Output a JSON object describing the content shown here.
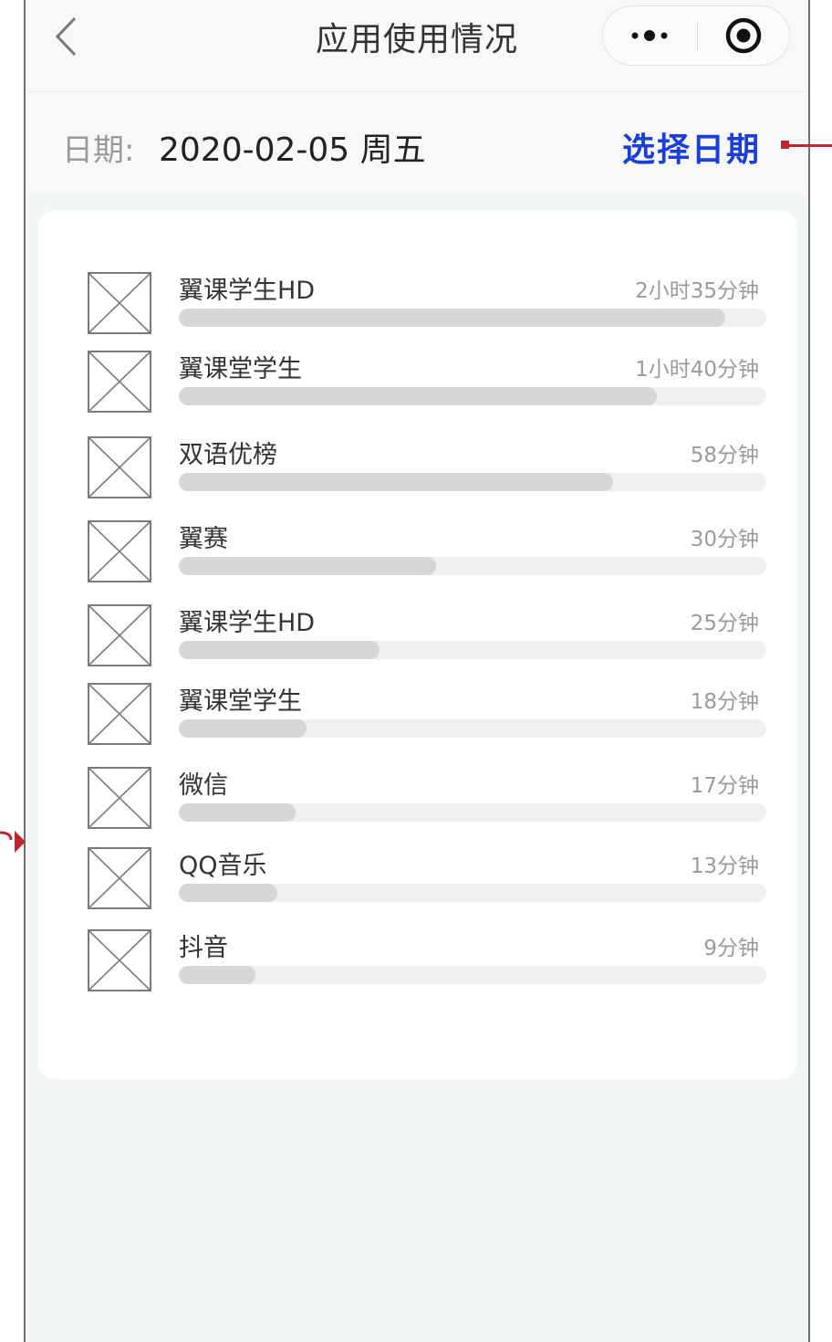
{
  "header": {
    "title": "应用使用情况",
    "back_icon": "chevron-left-icon",
    "more_icon": "more-dots-icon",
    "close_icon": "target-circle-icon"
  },
  "date_bar": {
    "label": "日期:",
    "value": "2020-02-05 周五",
    "pick_label": "选择日期"
  },
  "colors": {
    "accent": "#1a3fd8",
    "bar_fill": "#d6d6d6",
    "bar_track": "#f0f0f0",
    "annotation": "#c0262d"
  },
  "apps": [
    {
      "name": "翼课学生HD",
      "time": "2小时35分钟",
      "minutes": 155
    },
    {
      "name": "翼课堂学生",
      "time": "1小时40分钟",
      "minutes": 100
    },
    {
      "name": "双语优榜",
      "time": "58分钟",
      "minutes": 58
    },
    {
      "name": "翼赛",
      "time": "30分钟",
      "minutes": 30
    },
    {
      "name": "翼课学生HD",
      "time": "25分钟",
      "minutes": 25
    },
    {
      "name": "翼课堂学生",
      "time": "18分钟",
      "minutes": 18
    },
    {
      "name": "微信",
      "time": "17分钟",
      "minutes": 17
    },
    {
      "name": "QQ音乐",
      "time": "13分钟",
      "minutes": 13
    },
    {
      "name": "抖音",
      "time": "9分钟",
      "minutes": 9
    }
  ],
  "bar_fill_fractions": [
    0.93,
    0.814,
    0.739,
    0.438,
    0.342,
    0.217,
    0.199,
    0.168,
    0.13
  ]
}
